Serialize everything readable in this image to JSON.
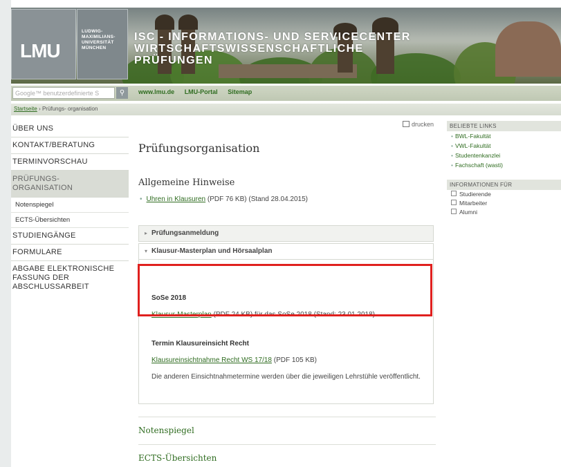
{
  "header": {
    "logo_text_1": "LMU",
    "logo_subtitle": [
      "LUDWIG-",
      "MAXIMILIANS-",
      "UNIVERSITÄT",
      "MÜNCHEN"
    ],
    "banner_line_1": "ISC - INFORMATIONS- UND SERVICECENTER",
    "banner_line_2": "WIRTSCHAFTSWISSENSCHAFTLICHE PRÜFUNGEN"
  },
  "nav": {
    "search_placeholder": "Google™ benutzerdefinierte S",
    "search_icon": "magnifier-icon",
    "links": [
      "www.lmu.de",
      "LMU-Portal",
      "Sitemap"
    ]
  },
  "breadcrumb": {
    "home": "Startseite",
    "sep": "›",
    "current": "Prüfungs- organisation"
  },
  "sidebar": {
    "items": [
      {
        "label": "ÜBER UNS"
      },
      {
        "label": "KONTAKT/BERATUNG"
      },
      {
        "label": "TERMINVORSCHAU"
      },
      {
        "label": "PRÜFUNGS-"
      },
      {
        "label": "ORGANISATION"
      },
      {
        "label": "Notenspiegel"
      },
      {
        "label": "ECTS-Übersichten"
      },
      {
        "label": "STUDIENGÄNGE"
      },
      {
        "label": "FORMULARE"
      },
      {
        "label": "ABGABE ELEKTRONISCHE"
      },
      {
        "label": "FASSUNG DER"
      },
      {
        "label": "ABSCHLUSSARBEIT"
      }
    ]
  },
  "main": {
    "print_label": "drucken",
    "title": "Prüfungsorganisation",
    "section_title": "Allgemeine Hinweise",
    "bullet_link": "Uhren in Klausuren",
    "bullet_text": " (PDF 76 KB) (Stand 28.04.2015)",
    "accordion_1": "Prüfungsanmeldung",
    "accordion_2": "Klausur-Masterplan und Hörsaalplan",
    "sose_title": "SoSe 2018",
    "masterplan_link": "Klausur-Masterplan",
    "masterplan_text": " (PDF 24 KB) für das SoSe 2018 (Stand: 23.01.2018)",
    "einsicht_title": "Termin Klausureinsicht Recht",
    "einsicht_link": "Klausureinsichtnahme Recht WS 17/18",
    "einsicht_text": " (PDF 105 KB)",
    "einsicht_note": "Die anderen Einsichtnahmetermine werden über die jeweiligen Lehrstühle veröffentlicht.",
    "footer_link_1": "Notenspiegel",
    "footer_link_2": "ECTS-Übersichten"
  },
  "right": {
    "popular_head": "BELIEBTE LINKS",
    "popular": [
      "BWL-Fakultät",
      "VWL-Fakultät",
      "Studentenkanzlei",
      "Fachschaft (wasti)"
    ],
    "info_head": "INFORMATIONEN FÜR",
    "info": [
      "Studierende",
      "Mitarbeiter",
      "Alumni"
    ]
  },
  "colors": {
    "link_green": "#2f6c20",
    "highlight_red": "#e0201e"
  }
}
